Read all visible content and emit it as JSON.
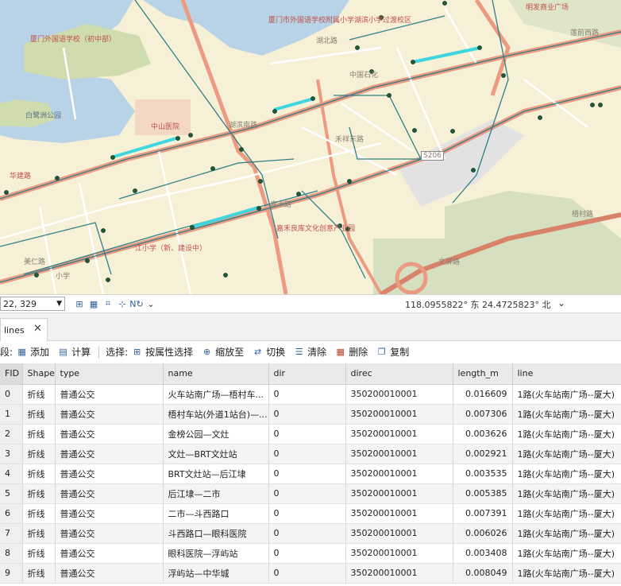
{
  "map": {
    "labels": {
      "school_xiamen_foreign": "厦门外国语学校（初中部）",
      "school_attached": "厦门市外国语学校附属小学湖滨小学过渡校区",
      "mall": "明发商业广场",
      "lake_park": "白鹭洲公园",
      "hospital": "中山医院",
      "china_bank": "中国石化",
      "road_hubei": "湖北路",
      "road_yuqian": "莲前西路",
      "road_huabei": "华建路",
      "culture_park": "嘉禾良库文化创意产业园",
      "school_bottom": "江小学（新、建设中）",
      "route_s206": "S206",
      "road_hubin": "湖滨南路",
      "road_jiahe": "嘉禾路",
      "road_meiren": "美仁路",
      "road_hedong": "禾祥东路",
      "road_wenping": "文屏路",
      "road_tailu": "梧村路",
      "lbl_hua": "华西",
      "lbl_xiaoxue": "小学"
    }
  },
  "statusbar": {
    "scale_value": "22, 329",
    "coordinates": "118.0955822° 东  24.4725823° 北"
  },
  "tab": {
    "label": "lines"
  },
  "toolbar": {
    "field_label": "段:",
    "add": "添加",
    "calculate": "计算",
    "selection_label": "选择:",
    "select_by_attribute": "按属性选择",
    "zoom_to": "缩放至",
    "switch": "切换",
    "clear": "清除",
    "delete": "删除",
    "copy": "复制"
  },
  "table": {
    "columns": [
      "FID",
      "Shape",
      "type",
      "name",
      "dir",
      "direc",
      "length_m",
      "line"
    ],
    "rows": [
      [
        "0",
        "折线",
        "普通公交",
        "火车站南广场—梧村车...",
        "0",
        "350200010001",
        "0.016609",
        "1路(火车站南广场--厦大)"
      ],
      [
        "1",
        "折线",
        "普通公交",
        "梧村车站(外道1站台)—...",
        "0",
        "350200010001",
        "0.007306",
        "1路(火车站南广场--厦大)"
      ],
      [
        "2",
        "折线",
        "普通公交",
        "金榜公园—文灶",
        "0",
        "350200010001",
        "0.003626",
        "1路(火车站南广场--厦大)"
      ],
      [
        "3",
        "折线",
        "普通公交",
        "文灶—BRT文灶站",
        "0",
        "350200010001",
        "0.002921",
        "1路(火车站南广场--厦大)"
      ],
      [
        "4",
        "折线",
        "普通公交",
        "BRT文灶站—后江埭",
        "0",
        "350200010001",
        "0.003535",
        "1路(火车站南广场--厦大)"
      ],
      [
        "5",
        "折线",
        "普通公交",
        "后江埭—二市",
        "0",
        "350200010001",
        "0.005385",
        "1路(火车站南广场--厦大)"
      ],
      [
        "6",
        "折线",
        "普通公交",
        "二市—斗西路口",
        "0",
        "350200010001",
        "0.007391",
        "1路(火车站南广场--厦大)"
      ],
      [
        "7",
        "折线",
        "普通公交",
        "斗西路口—眼科医院",
        "0",
        "350200010001",
        "0.006026",
        "1路(火车站南广场--厦大)"
      ],
      [
        "8",
        "折线",
        "普通公交",
        "眼科医院—浮屿站",
        "0",
        "350200010001",
        "0.003408",
        "1路(火车站南广场--厦大)"
      ],
      [
        "9",
        "折线",
        "普通公交",
        "浮屿站—中华城",
        "0",
        "350200010001",
        "0.008049",
        "1路(火车站南广场--厦大)"
      ]
    ]
  }
}
